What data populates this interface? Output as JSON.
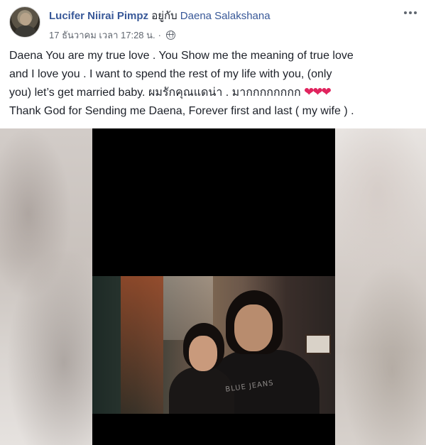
{
  "post": {
    "author_name": "Lucifer Niirai Pimpz",
    "with_text": "อยู่กับ",
    "tagged_name": "Daena Salakshana",
    "timestamp": "17 ธันวาคม เวลา 17:28 น.",
    "separator": "·",
    "privacy_icon": "globe-icon",
    "menu_icon": "more-options-icon",
    "text_lines": [
      "Daena You are my true love . You Show me the meaning of true love",
      "and I love you . I want to spend the rest of my life with you, (only",
      "you) let’s get married baby. ผมรักคุณแดน่า . มากกกกกกกก",
      "Thank God for Sending me Daena, Forever first and last ( my wife ) ."
    ],
    "hearts": "❤❤❤",
    "photo_print": "BLUE JEANS"
  },
  "colors": {
    "link": "#385898",
    "meta": "#616770",
    "text": "#1d2129",
    "heart": "#e0245e"
  }
}
